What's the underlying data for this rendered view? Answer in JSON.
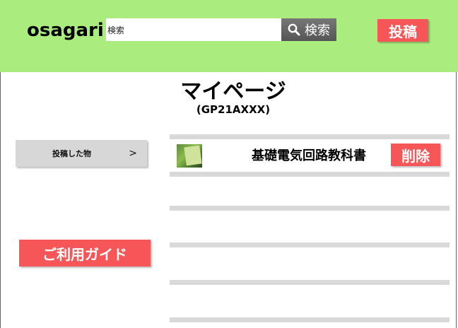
{
  "header": {
    "logo": "osagari",
    "search": {
      "value": "検索",
      "button_label": "検索",
      "icon": "search-icon"
    },
    "post_label": "投稿"
  },
  "page": {
    "title": "マイページ",
    "user_id": "(GP21AXXX)"
  },
  "sidebar": {
    "items": [
      {
        "label": "投稿した物",
        "arrow": ">"
      }
    ],
    "guide_label": "ご利用ガイド"
  },
  "posts": [
    {
      "title": "基礎電気回路教科書",
      "delete_label": "削除"
    }
  ],
  "colors": {
    "header_bg": "#abec7f",
    "accent_red": "#f65657",
    "separator": "#d9d9d9"
  }
}
